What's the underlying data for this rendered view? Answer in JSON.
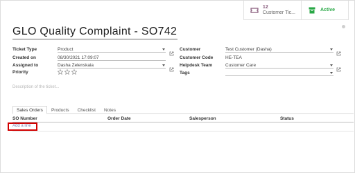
{
  "stat_buttons": {
    "tickets": {
      "value": "12",
      "label": "Customer Tic...",
      "icon": "ticket-icon"
    },
    "active": {
      "label": "Active",
      "icon": "archive-icon"
    }
  },
  "ticket": {
    "title": "GLO Quality Complaint - SO742"
  },
  "fields": {
    "ticket_type": {
      "label": "Ticket Type",
      "value": "Product"
    },
    "created_on": {
      "label": "Created on",
      "value": "08/30/2021 17:09:07"
    },
    "assigned_to": {
      "label": "Assigned to",
      "value": "Dasha Zelenskaia"
    },
    "priority": {
      "label": "Priority",
      "stars": 0,
      "max": 3
    },
    "customer": {
      "label": "Customer",
      "value": "Test Customer (Dasha)"
    },
    "customer_code": {
      "label": "Customer Code",
      "value": "HE-TEA"
    },
    "helpdesk_team": {
      "label": "Helpdesk Team",
      "value": "Customer Care"
    },
    "tags": {
      "label": "Tags",
      "value": ""
    }
  },
  "description_placeholder": "Description of the ticket...",
  "tabs": [
    "Sales Orders",
    "Products",
    "Checklist",
    "Notes"
  ],
  "table": {
    "columns": [
      "SO Number",
      "Order Date",
      "Salesperson",
      "Status"
    ],
    "add_line": "Add a line"
  },
  "colors": {
    "accent": "#875a7b",
    "active": "#28a745",
    "highlight": "#d10000",
    "link": "#7c7bad"
  }
}
